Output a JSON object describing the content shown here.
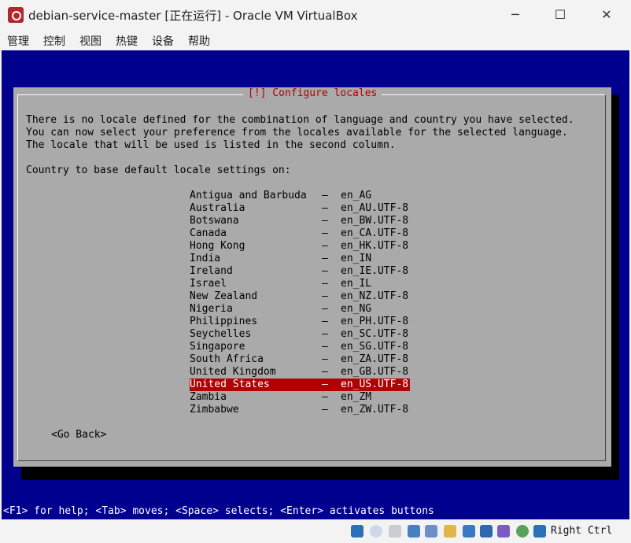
{
  "window": {
    "title": "debian-service-master [正在运行] - Oracle VM VirtualBox",
    "minimize": "─",
    "maximize": "☐",
    "close": "✕"
  },
  "menu": [
    "管理",
    "控制",
    "视图",
    "热键",
    "设备",
    "帮助"
  ],
  "dialog": {
    "title": "[!] Configure locales",
    "paragraph": "There is no locale defined for the combination of language and country you have selected.\nYou can now select your preference from the locales available for the selected language.\nThe locale that will be used is listed in the second column.",
    "prompt": "Country to base default locale settings on:",
    "items": [
      {
        "country": "Antigua and Barbuda",
        "locale": "en_AG"
      },
      {
        "country": "Australia",
        "locale": "en_AU.UTF-8"
      },
      {
        "country": "Botswana",
        "locale": "en_BW.UTF-8"
      },
      {
        "country": "Canada",
        "locale": "en_CA.UTF-8"
      },
      {
        "country": "Hong Kong",
        "locale": "en_HK.UTF-8"
      },
      {
        "country": "India",
        "locale": "en_IN"
      },
      {
        "country": "Ireland",
        "locale": "en_IE.UTF-8"
      },
      {
        "country": "Israel",
        "locale": "en_IL"
      },
      {
        "country": "New Zealand",
        "locale": "en_NZ.UTF-8"
      },
      {
        "country": "Nigeria",
        "locale": "en_NG"
      },
      {
        "country": "Philippines",
        "locale": "en_PH.UTF-8"
      },
      {
        "country": "Seychelles",
        "locale": "en_SC.UTF-8"
      },
      {
        "country": "Singapore",
        "locale": "en_SG.UTF-8"
      },
      {
        "country": "South Africa",
        "locale": "en_ZA.UTF-8"
      },
      {
        "country": "United Kingdom",
        "locale": "en_GB.UTF-8"
      },
      {
        "country": "United States",
        "locale": "en_US.UTF-8"
      },
      {
        "country": "Zambia",
        "locale": "en_ZM"
      },
      {
        "country": "Zimbabwe",
        "locale": "en_ZW.UTF-8"
      }
    ],
    "separator": "–",
    "selected_country": "United States",
    "go_back": "<Go Back>"
  },
  "help_line": "<F1> for help; <Tab> moves; <Space> selects; <Enter> activates buttons",
  "status": {
    "host_key": "Right Ctrl",
    "icons": [
      "help-icon",
      "optical-disc-icon",
      "audio-icon",
      "network-icon",
      "usb-icon",
      "shared-folders-icon",
      "display-icon",
      "screen-icon",
      "recording-icon",
      "cpu-icon",
      "mouse-integration-icon",
      "keyboard-icon"
    ]
  },
  "colors": {
    "vm_background": "#00008f",
    "dialog": "#aaaaaa",
    "accent": "#b00000"
  }
}
